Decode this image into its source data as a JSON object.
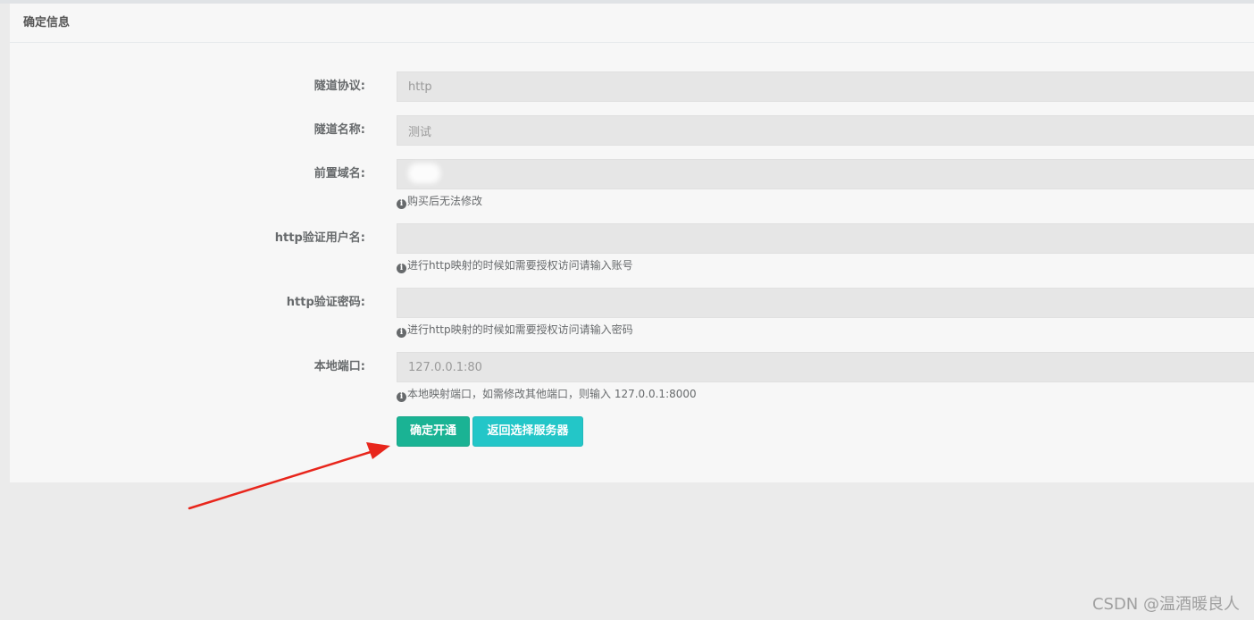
{
  "panel": {
    "title": "确定信息"
  },
  "form": {
    "protocol": {
      "label": "隧道协议:",
      "value": "http"
    },
    "tunnel_name": {
      "label": "隧道名称:",
      "value": "测试"
    },
    "prefix_domain": {
      "label": "前置域名:",
      "value": "",
      "help": "购买后无法修改"
    },
    "http_user": {
      "label": "http验证用户名:",
      "value": "",
      "help": "进行http映射的时候如需要授权访问请输入账号"
    },
    "http_password": {
      "label": "http验证密码:",
      "value": "",
      "help": "进行http映射的时候如需要授权访问请输入密码"
    },
    "local_port": {
      "label": "本地端口:",
      "value": "127.0.0.1:80",
      "help": "本地映射端口，如需修改其他端口，则输入 127.0.0.1:8000"
    }
  },
  "actions": {
    "confirm_label": "确定开通",
    "back_label": "返回选择服务器"
  },
  "icons": {
    "info": "info-circle-icon"
  },
  "watermark": "CSDN @温酒暖良人",
  "colors": {
    "primary": "#1ab394",
    "info": "#23c6c8",
    "arrow": "#e8261c"
  }
}
